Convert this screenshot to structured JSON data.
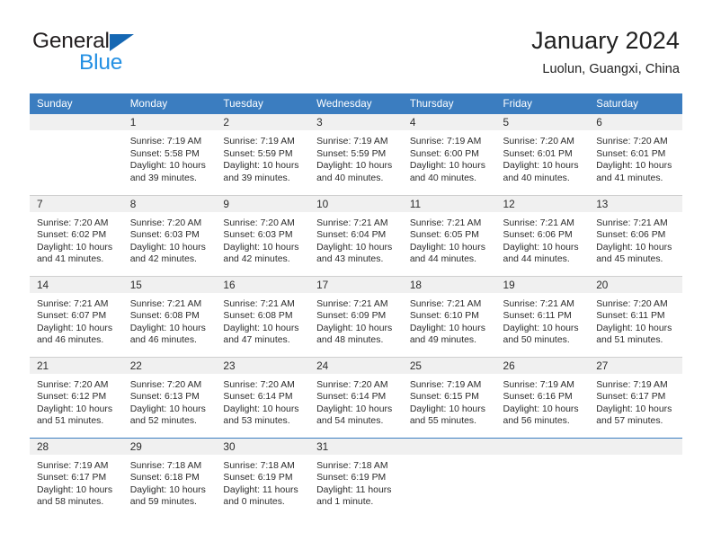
{
  "brand": {
    "name_part1": "General",
    "name_part2": "Blue",
    "triangle_color": "#1567b3",
    "blue_color": "#2490e3",
    "dark_color": "#231f20"
  },
  "header": {
    "title": "January 2024",
    "subtitle": "Luolun, Guangxi, China"
  },
  "theme": {
    "header_row_bg": "#3b7dc0",
    "daynum_band_bg": "#f0f0f0",
    "grid_line": "#cfcfcf",
    "text": "#2b2b2b"
  },
  "weekdays": [
    "Sunday",
    "Monday",
    "Tuesday",
    "Wednesday",
    "Thursday",
    "Friday",
    "Saturday"
  ],
  "weeks": [
    [
      {
        "day": "",
        "sunrise": "",
        "sunset": "",
        "daylight1": "",
        "daylight2": ""
      },
      {
        "day": "1",
        "sunrise": "Sunrise: 7:19 AM",
        "sunset": "Sunset: 5:58 PM",
        "daylight1": "Daylight: 10 hours",
        "daylight2": "and 39 minutes."
      },
      {
        "day": "2",
        "sunrise": "Sunrise: 7:19 AM",
        "sunset": "Sunset: 5:59 PM",
        "daylight1": "Daylight: 10 hours",
        "daylight2": "and 39 minutes."
      },
      {
        "day": "3",
        "sunrise": "Sunrise: 7:19 AM",
        "sunset": "Sunset: 5:59 PM",
        "daylight1": "Daylight: 10 hours",
        "daylight2": "and 40 minutes."
      },
      {
        "day": "4",
        "sunrise": "Sunrise: 7:19 AM",
        "sunset": "Sunset: 6:00 PM",
        "daylight1": "Daylight: 10 hours",
        "daylight2": "and 40 minutes."
      },
      {
        "day": "5",
        "sunrise": "Sunrise: 7:20 AM",
        "sunset": "Sunset: 6:01 PM",
        "daylight1": "Daylight: 10 hours",
        "daylight2": "and 40 minutes."
      },
      {
        "day": "6",
        "sunrise": "Sunrise: 7:20 AM",
        "sunset": "Sunset: 6:01 PM",
        "daylight1": "Daylight: 10 hours",
        "daylight2": "and 41 minutes."
      }
    ],
    [
      {
        "day": "7",
        "sunrise": "Sunrise: 7:20 AM",
        "sunset": "Sunset: 6:02 PM",
        "daylight1": "Daylight: 10 hours",
        "daylight2": "and 41 minutes."
      },
      {
        "day": "8",
        "sunrise": "Sunrise: 7:20 AM",
        "sunset": "Sunset: 6:03 PM",
        "daylight1": "Daylight: 10 hours",
        "daylight2": "and 42 minutes."
      },
      {
        "day": "9",
        "sunrise": "Sunrise: 7:20 AM",
        "sunset": "Sunset: 6:03 PM",
        "daylight1": "Daylight: 10 hours",
        "daylight2": "and 42 minutes."
      },
      {
        "day": "10",
        "sunrise": "Sunrise: 7:21 AM",
        "sunset": "Sunset: 6:04 PM",
        "daylight1": "Daylight: 10 hours",
        "daylight2": "and 43 minutes."
      },
      {
        "day": "11",
        "sunrise": "Sunrise: 7:21 AM",
        "sunset": "Sunset: 6:05 PM",
        "daylight1": "Daylight: 10 hours",
        "daylight2": "and 44 minutes."
      },
      {
        "day": "12",
        "sunrise": "Sunrise: 7:21 AM",
        "sunset": "Sunset: 6:06 PM",
        "daylight1": "Daylight: 10 hours",
        "daylight2": "and 44 minutes."
      },
      {
        "day": "13",
        "sunrise": "Sunrise: 7:21 AM",
        "sunset": "Sunset: 6:06 PM",
        "daylight1": "Daylight: 10 hours",
        "daylight2": "and 45 minutes."
      }
    ],
    [
      {
        "day": "14",
        "sunrise": "Sunrise: 7:21 AM",
        "sunset": "Sunset: 6:07 PM",
        "daylight1": "Daylight: 10 hours",
        "daylight2": "and 46 minutes."
      },
      {
        "day": "15",
        "sunrise": "Sunrise: 7:21 AM",
        "sunset": "Sunset: 6:08 PM",
        "daylight1": "Daylight: 10 hours",
        "daylight2": "and 46 minutes."
      },
      {
        "day": "16",
        "sunrise": "Sunrise: 7:21 AM",
        "sunset": "Sunset: 6:08 PM",
        "daylight1": "Daylight: 10 hours",
        "daylight2": "and 47 minutes."
      },
      {
        "day": "17",
        "sunrise": "Sunrise: 7:21 AM",
        "sunset": "Sunset: 6:09 PM",
        "daylight1": "Daylight: 10 hours",
        "daylight2": "and 48 minutes."
      },
      {
        "day": "18",
        "sunrise": "Sunrise: 7:21 AM",
        "sunset": "Sunset: 6:10 PM",
        "daylight1": "Daylight: 10 hours",
        "daylight2": "and 49 minutes."
      },
      {
        "day": "19",
        "sunrise": "Sunrise: 7:21 AM",
        "sunset": "Sunset: 6:11 PM",
        "daylight1": "Daylight: 10 hours",
        "daylight2": "and 50 minutes."
      },
      {
        "day": "20",
        "sunrise": "Sunrise: 7:20 AM",
        "sunset": "Sunset: 6:11 PM",
        "daylight1": "Daylight: 10 hours",
        "daylight2": "and 51 minutes."
      }
    ],
    [
      {
        "day": "21",
        "sunrise": "Sunrise: 7:20 AM",
        "sunset": "Sunset: 6:12 PM",
        "daylight1": "Daylight: 10 hours",
        "daylight2": "and 51 minutes."
      },
      {
        "day": "22",
        "sunrise": "Sunrise: 7:20 AM",
        "sunset": "Sunset: 6:13 PM",
        "daylight1": "Daylight: 10 hours",
        "daylight2": "and 52 minutes."
      },
      {
        "day": "23",
        "sunrise": "Sunrise: 7:20 AM",
        "sunset": "Sunset: 6:14 PM",
        "daylight1": "Daylight: 10 hours",
        "daylight2": "and 53 minutes."
      },
      {
        "day": "24",
        "sunrise": "Sunrise: 7:20 AM",
        "sunset": "Sunset: 6:14 PM",
        "daylight1": "Daylight: 10 hours",
        "daylight2": "and 54 minutes."
      },
      {
        "day": "25",
        "sunrise": "Sunrise: 7:19 AM",
        "sunset": "Sunset: 6:15 PM",
        "daylight1": "Daylight: 10 hours",
        "daylight2": "and 55 minutes."
      },
      {
        "day": "26",
        "sunrise": "Sunrise: 7:19 AM",
        "sunset": "Sunset: 6:16 PM",
        "daylight1": "Daylight: 10 hours",
        "daylight2": "and 56 minutes."
      },
      {
        "day": "27",
        "sunrise": "Sunrise: 7:19 AM",
        "sunset": "Sunset: 6:17 PM",
        "daylight1": "Daylight: 10 hours",
        "daylight2": "and 57 minutes."
      }
    ],
    [
      {
        "day": "28",
        "sunrise": "Sunrise: 7:19 AM",
        "sunset": "Sunset: 6:17 PM",
        "daylight1": "Daylight: 10 hours",
        "daylight2": "and 58 minutes."
      },
      {
        "day": "29",
        "sunrise": "Sunrise: 7:18 AM",
        "sunset": "Sunset: 6:18 PM",
        "daylight1": "Daylight: 10 hours",
        "daylight2": "and 59 minutes."
      },
      {
        "day": "30",
        "sunrise": "Sunrise: 7:18 AM",
        "sunset": "Sunset: 6:19 PM",
        "daylight1": "Daylight: 11 hours",
        "daylight2": "and 0 minutes."
      },
      {
        "day": "31",
        "sunrise": "Sunrise: 7:18 AM",
        "sunset": "Sunset: 6:19 PM",
        "daylight1": "Daylight: 11 hours",
        "daylight2": "and 1 minute."
      },
      {
        "day": "",
        "sunrise": "",
        "sunset": "",
        "daylight1": "",
        "daylight2": ""
      },
      {
        "day": "",
        "sunrise": "",
        "sunset": "",
        "daylight1": "",
        "daylight2": ""
      },
      {
        "day": "",
        "sunrise": "",
        "sunset": "",
        "daylight1": "",
        "daylight2": ""
      }
    ]
  ]
}
